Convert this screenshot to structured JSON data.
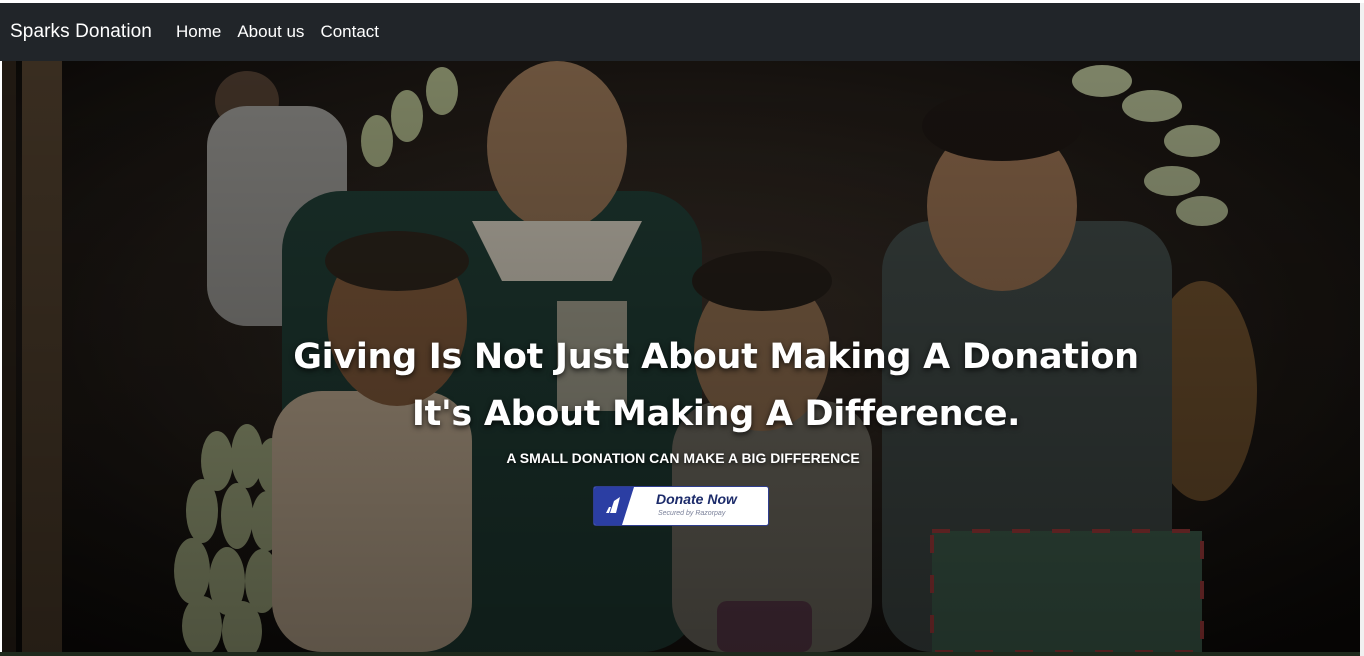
{
  "navbar": {
    "brand": "Sparks Donation",
    "links": [
      "Home",
      "About us",
      "Contact"
    ]
  },
  "hero": {
    "headline_line1": "Giving Is Not Just About Making A Donation",
    "headline_line2": "It's About Making A Difference.",
    "subheadline": "A SMALL DONATION CAN MAKE A BIG DIFFERENCE",
    "image_icon": "photo-children-and-woman-carrying-bananas"
  },
  "donate_button": {
    "label": "Donate Now",
    "secured_text": "Secured by Razorpay",
    "icon": "razorpay-logo-icon"
  },
  "colors": {
    "navbar_bg": "#212529",
    "text_white": "#ffffff",
    "button_navy": "#2f3d8e",
    "button_text": "#1c2b6a"
  }
}
